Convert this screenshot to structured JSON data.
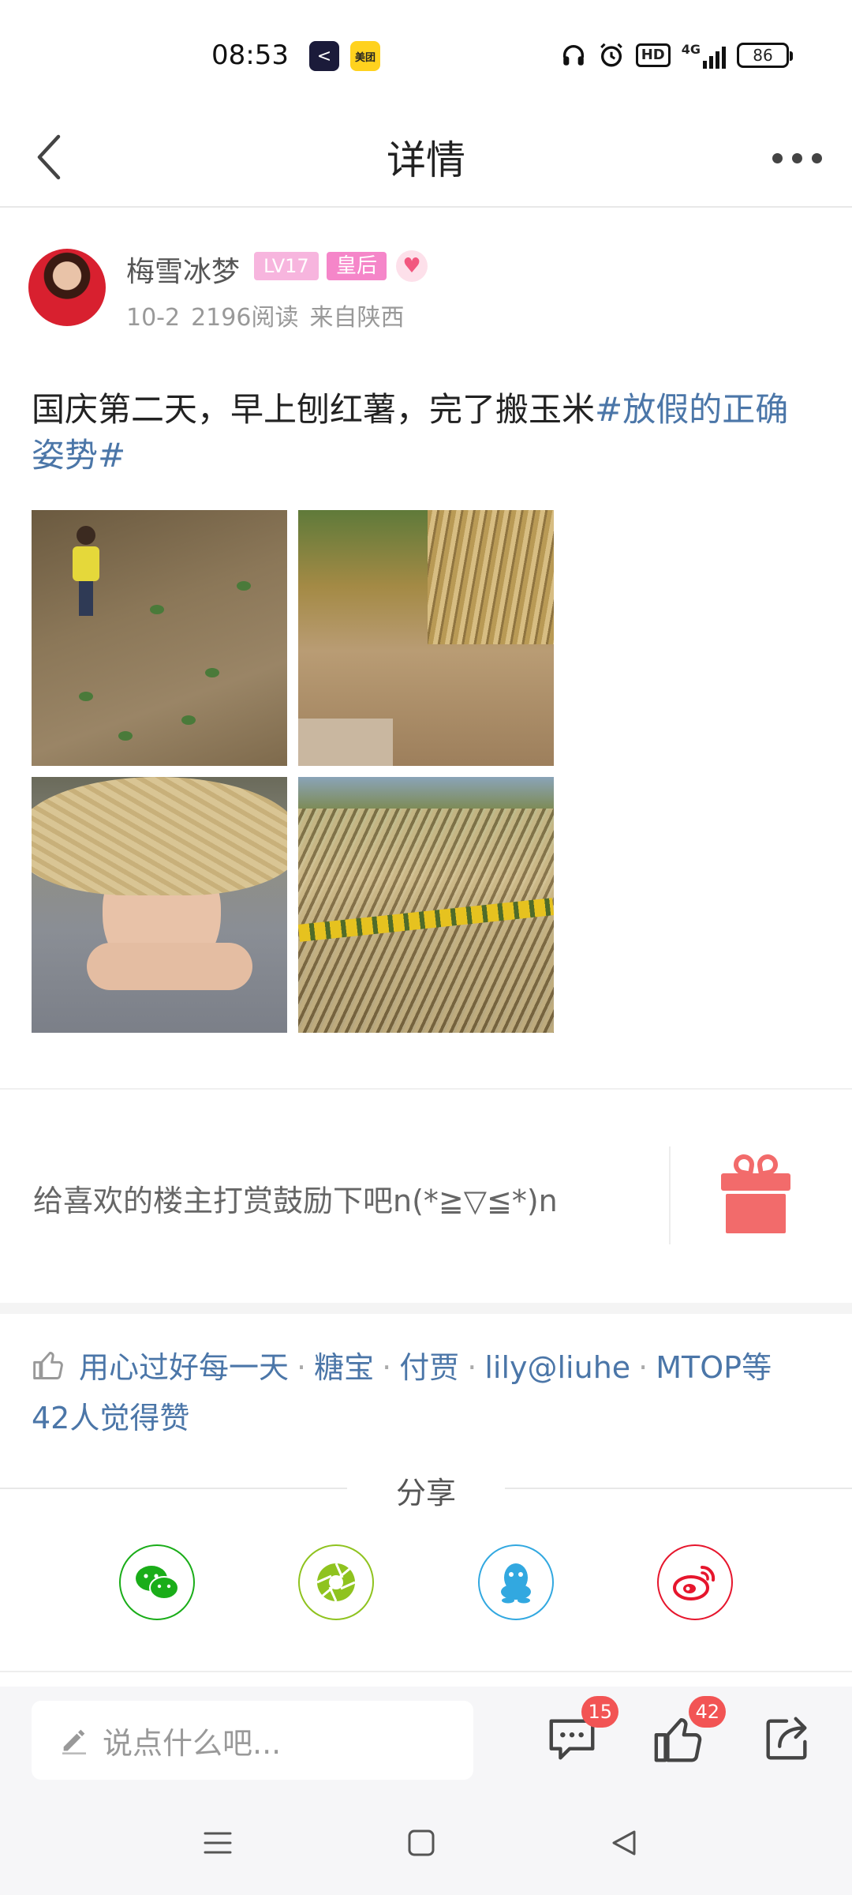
{
  "status_bar": {
    "time": "08:53",
    "app1_glyph": "<",
    "app2_label": "美团",
    "hd_label": "HD",
    "network_label": "4G",
    "battery": "86"
  },
  "header": {
    "title": "详情"
  },
  "author": {
    "name": "梅雪冰梦",
    "level_badge": "LV17",
    "title_badge": "皇后",
    "date": "10-2",
    "reads": "2196阅读",
    "location": "来自陕西"
  },
  "post": {
    "text": "国庆第二天，早上刨红薯，完了搬玉米",
    "topic": "#放假的正确姿势#"
  },
  "reward": {
    "text": "给喜欢的楼主打赏鼓励下吧n(*≧▽≦*)n"
  },
  "likes": {
    "users": [
      "用心过好每一天",
      "糖宝",
      "付贾",
      "lily@liuhe",
      "MTOP等"
    ],
    "summary": "42人觉得赞"
  },
  "share": {
    "title": "分享",
    "targets": [
      "wechat-icon",
      "moments-icon",
      "qq-icon",
      "weibo-icon"
    ]
  },
  "bottom_bar": {
    "comment_placeholder": "说点什么吧...",
    "comment_count": "15",
    "like_count": "42"
  },
  "colors": {
    "link_blue": "#4b76a8",
    "badge_red": "#f25454",
    "gift_red": "#f26b6b"
  }
}
